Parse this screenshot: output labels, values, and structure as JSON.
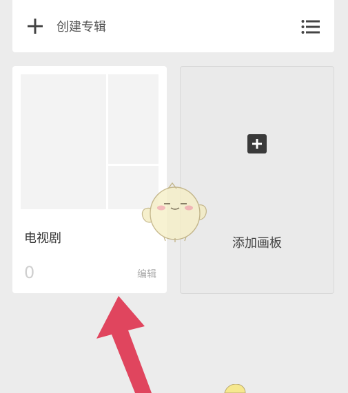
{
  "toolbar": {
    "create_album_label": "创建专辑",
    "plus_icon": "plus-icon",
    "list_view_icon": "list-icon"
  },
  "albums": [
    {
      "title": "电视剧",
      "count": "0",
      "edit_label": "编辑"
    }
  ],
  "add_board": {
    "label": "添加画板",
    "icon": "plus-square-icon"
  },
  "colors": {
    "background": "#ececec",
    "card": "#ffffff",
    "arrow": "#e0455e"
  }
}
